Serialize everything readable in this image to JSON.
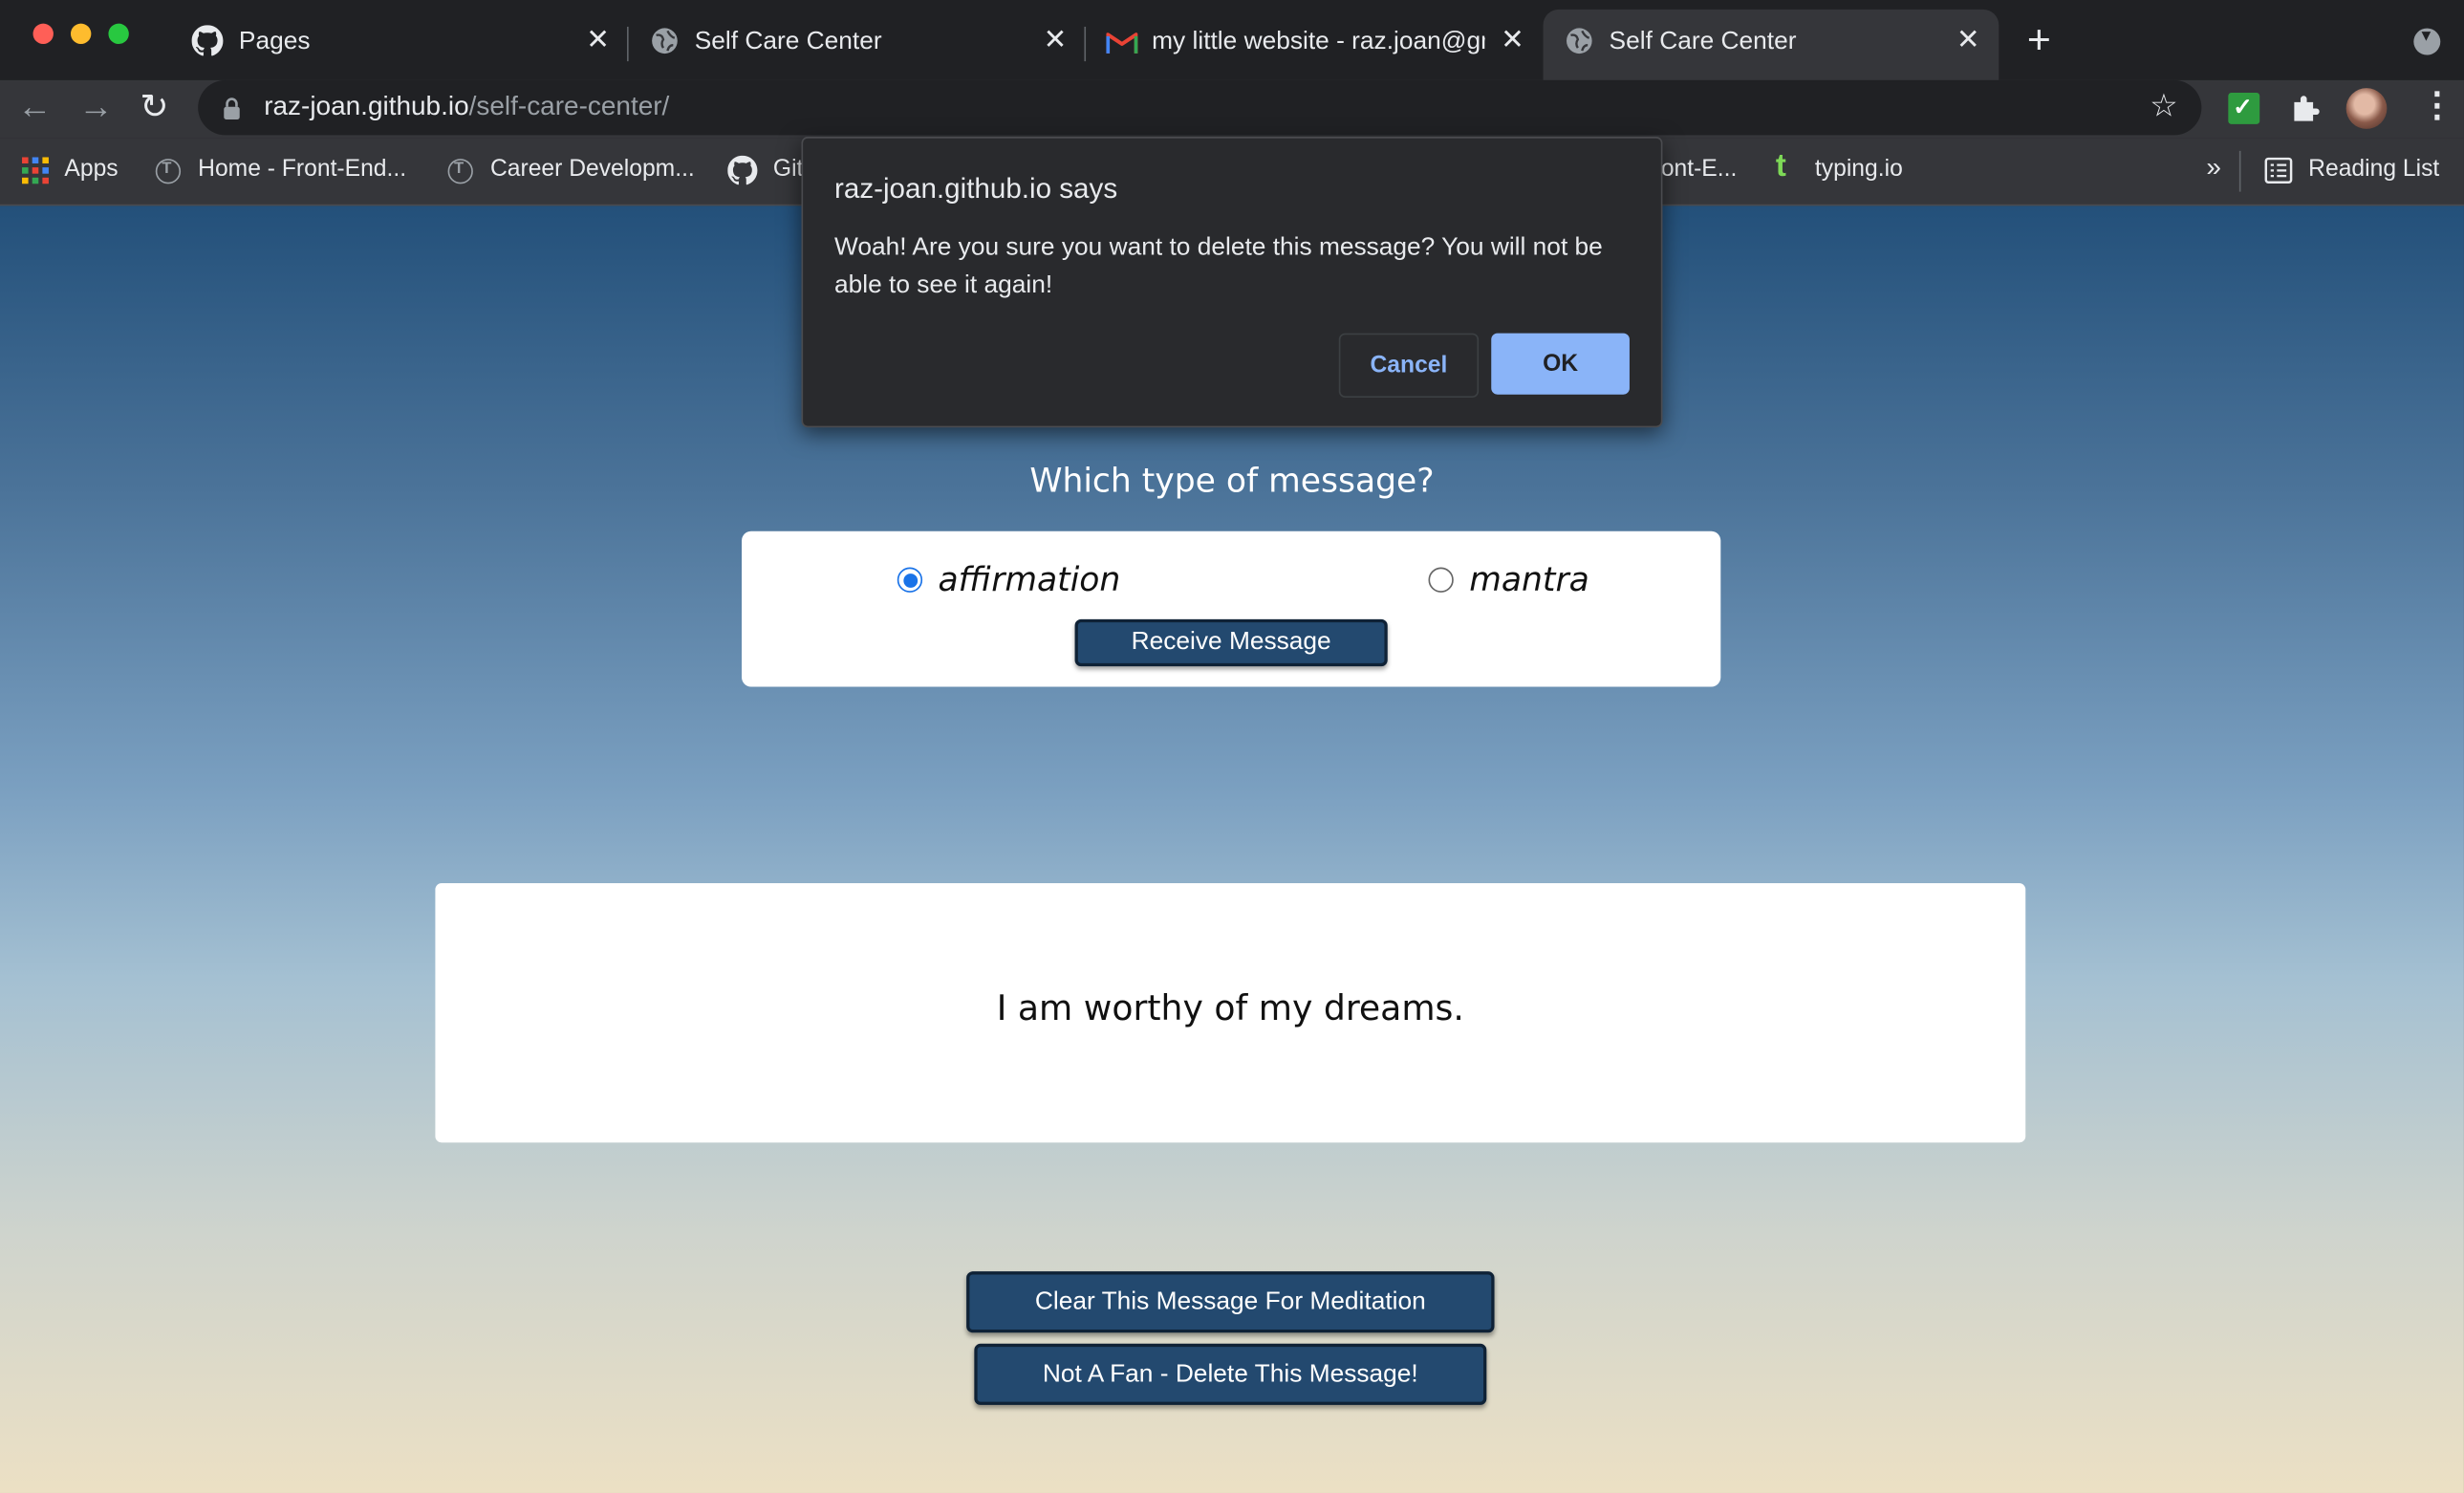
{
  "browser": {
    "tabs": [
      {
        "label": "Pages",
        "icon": "github-icon"
      },
      {
        "label": "Self Care Center",
        "icon": "globe-icon"
      },
      {
        "label": "my little website - raz.joan@gmail.com",
        "icon": "gmail-icon"
      },
      {
        "label": "Self Care Center",
        "icon": "globe-icon",
        "active": true
      }
    ],
    "address": {
      "host": "raz-joan.github.io",
      "path": "/self-care-center/"
    },
    "bookmarks": [
      {
        "label": "Apps",
        "icon": "apps-grid-icon"
      },
      {
        "label": "Home - Front-End...",
        "icon": "turing-icon"
      },
      {
        "label": "Career Developm...",
        "icon": "turing-icon"
      },
      {
        "label": "Git",
        "icon": "github-icon"
      },
      {
        "label": "ont-E...",
        "icon": ""
      },
      {
        "label": "typing.io",
        "icon": "typing-icon"
      }
    ],
    "overflow": "»",
    "reading_list": "Reading List"
  },
  "dialog": {
    "title": "raz-joan.github.io says",
    "message": "Woah! Are you sure you want to delete this message? You will not be able to see it again!",
    "cancel": "Cancel",
    "ok": "OK"
  },
  "page": {
    "question": "Which type of message?",
    "options": [
      "affirmation",
      "mantra"
    ],
    "selected": "affirmation",
    "receive_button": "Receive Message",
    "message": "I am worthy of my dreams.",
    "clear_button": "Clear This Message For Meditation",
    "delete_button": "Not A Fan - Delete This Message!"
  },
  "colors": {
    "accent": "#8ab4f8",
    "button": "#23496f",
    "radio": "#1a73e8"
  }
}
